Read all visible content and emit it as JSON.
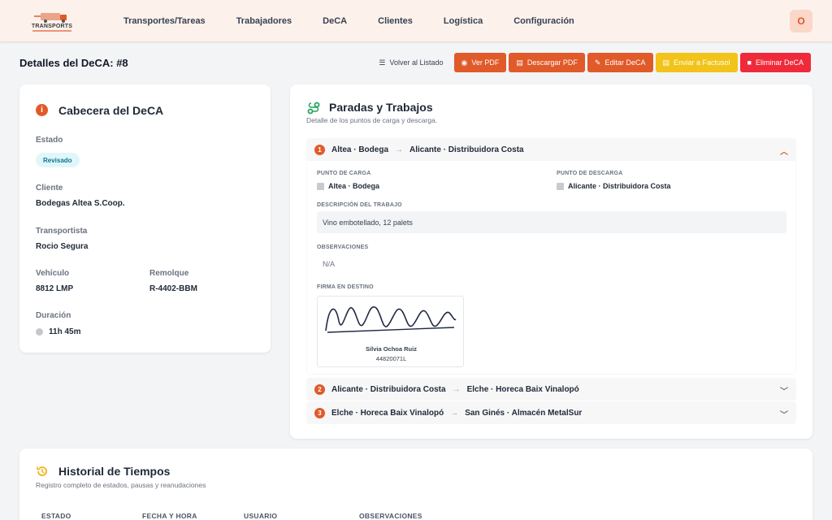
{
  "brand": {
    "logo_text": "TRANSPORTS",
    "accent": "#e05a2a"
  },
  "nav": [
    "Transportes/Tareas",
    "Trabajadores",
    "DeCA",
    "Clientes",
    "Logística",
    "Configuración"
  ],
  "user": {
    "initial": "O"
  },
  "page": {
    "title": "Detalles del DeCA: #8"
  },
  "actions": {
    "back": "Volver al Listado",
    "view_pdf": "Ver PDF",
    "download_pdf": "Descargar PDF",
    "edit": "Editar DeCA",
    "send": "Enviar a Factusol",
    "delete": "Eliminar DeCA"
  },
  "header_card": {
    "title": "Cabecera del DeCA",
    "estado_label": "Estado",
    "estado": "Revisado",
    "cliente_label": "Cliente",
    "cliente": "Bodegas Altea S.Coop.",
    "transportista_label": "Transportista",
    "transportista": "Rocio Segura",
    "vehiculo_label": "Vehículo",
    "vehiculo": "8812 LMP",
    "remolque_label": "Remolque",
    "remolque": "R-4402-BBM",
    "duracion_label": "Duración",
    "duracion": "11h 45m"
  },
  "stops_card": {
    "title": "Paradas y Trabajos",
    "subtitle": "Detalle de los puntos de carga y descarga.",
    "stops": [
      {
        "num": "1",
        "from": "Altea · Bodega",
        "to": "Alicante · Distribuidora Costa"
      },
      {
        "num": "2",
        "from": "Alicante · Distribuidora Costa",
        "to": "Elche · Horeca Baix Vinalopó"
      },
      {
        "num": "3",
        "from": "Elche · Horeca Baix Vinalopó",
        "to": "San Ginés · Almacén MetalSur"
      }
    ],
    "detail": {
      "carga_label": "PUNTO DE CARGA",
      "carga": "Altea · Bodega",
      "descarga_label": "PUNTO DE DESCARGA",
      "descarga": "Alicante · Distribuidora Costa",
      "desc_label": "DESCRIPCIÓN DEL TRABAJO",
      "desc": "Vino embotellado, 12 palets",
      "obs_label": "OBSERVACIONES",
      "obs": "N/A",
      "firma_label": "FIRMA EN DESTINO",
      "firma_name": "Silvia Ochoa Ruiz",
      "firma_id": "44820071L"
    }
  },
  "history": {
    "title": "Historial de Tiempos",
    "subtitle": "Registro completo de estados, pausas y reanudaciones",
    "columns": [
      "ESTADO",
      "FECHA Y HORA",
      "USUARIO",
      "OBSERVACIONES"
    ]
  }
}
